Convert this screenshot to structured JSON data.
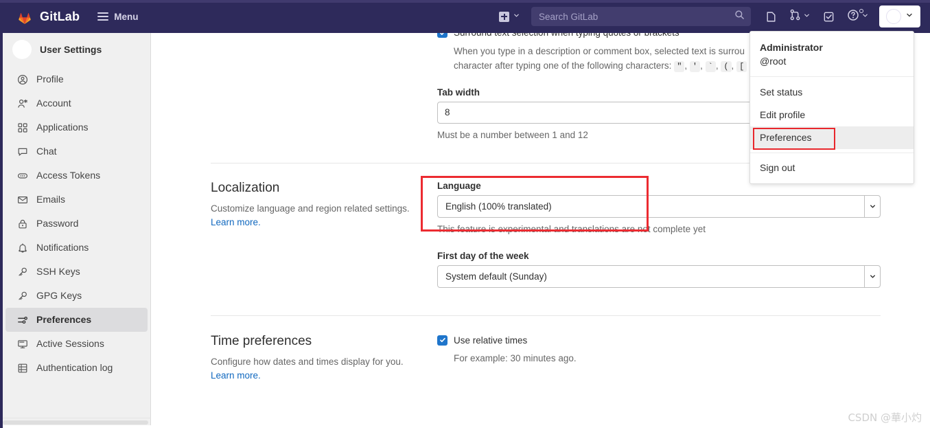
{
  "topnav": {
    "brand": "GitLab",
    "menu_label": "Menu",
    "brand_color": "#2e2a5b",
    "create_new_icon": "plus-square-icon",
    "create_new_caret_icon": "chevron-down-icon",
    "search": {
      "placeholder": "Search GitLab",
      "value": "",
      "icon": "search-icon"
    },
    "icons": [
      {
        "name": "issues-icon",
        "caret": false
      },
      {
        "name": "merge-requests-icon",
        "caret": true
      },
      {
        "name": "todos-done-icon",
        "caret": false
      },
      {
        "name": "help-question-icon",
        "caret": true,
        "badge": true
      }
    ],
    "avatar_caret_icon": "chevron-down-icon"
  },
  "user_dropdown": {
    "name": "Administrator",
    "handle": "@root",
    "items": [
      {
        "label": "Set status",
        "hovered": false
      },
      {
        "label": "Edit profile",
        "hovered": false
      },
      {
        "label": "Preferences",
        "hovered": true
      },
      {
        "label": "Sign out",
        "hovered": false
      }
    ],
    "highlight_color": "#e8272c"
  },
  "sidebar": {
    "title": "User Settings",
    "avatar_icon": "user-avatar-icon",
    "items": [
      {
        "label": "Profile",
        "icon": "profile-icon",
        "active": false
      },
      {
        "label": "Account",
        "icon": "account-icon",
        "active": false
      },
      {
        "label": "Applications",
        "icon": "applications-grid-icon",
        "active": false
      },
      {
        "label": "Chat",
        "icon": "chat-bubble-icon",
        "active": false
      },
      {
        "label": "Access Tokens",
        "icon": "token-icon",
        "active": false
      },
      {
        "label": "Emails",
        "icon": "envelope-icon",
        "active": false
      },
      {
        "label": "Password",
        "icon": "lock-icon",
        "active": false
      },
      {
        "label": "Notifications",
        "icon": "bell-icon",
        "active": false
      },
      {
        "label": "SSH Keys",
        "icon": "key-icon",
        "active": false
      },
      {
        "label": "GPG Keys",
        "icon": "key-icon",
        "active": false
      },
      {
        "label": "Preferences",
        "icon": "preferences-sliders-icon",
        "active": true
      },
      {
        "label": "Active Sessions",
        "icon": "monitor-icon",
        "active": false
      },
      {
        "label": "Authentication log",
        "icon": "log-grid-icon",
        "active": false
      }
    ]
  },
  "main": {
    "behavior_partial": {
      "checkbox_label": "Surround text selection when typing quotes or brackets",
      "checked": true,
      "help_line_1": "When you type in a description or comment box, selected text is surrou",
      "help_line_2_prefix": "character after typing one of the following characters: ",
      "help_chars": [
        "\"",
        "'",
        "`",
        "(",
        "["
      ]
    },
    "tab_width": {
      "label": "Tab width",
      "value": "8",
      "help": "Must be a number between 1 and 12"
    },
    "localization": {
      "title": "Localization",
      "desc": "Customize language and region related settings.",
      "learn_more": "Learn more.",
      "language": {
        "label": "Language",
        "value": "English (100% translated)",
        "help": "This feature is experimental and translations are not complete yet",
        "caret_icon": "chevron-down-icon"
      },
      "first_day": {
        "label": "First day of the week",
        "value": "System default (Sunday)",
        "caret_icon": "chevron-down-icon"
      },
      "highlight_color": "#ec2b31"
    },
    "time_preferences": {
      "title": "Time preferences",
      "desc": "Configure how dates and times display for you.",
      "learn_more": "Learn more.",
      "checkbox_label": "Use relative times",
      "checked": true,
      "example": "For example: 30 minutes ago."
    }
  },
  "watermark": "CSDN @華小灼"
}
